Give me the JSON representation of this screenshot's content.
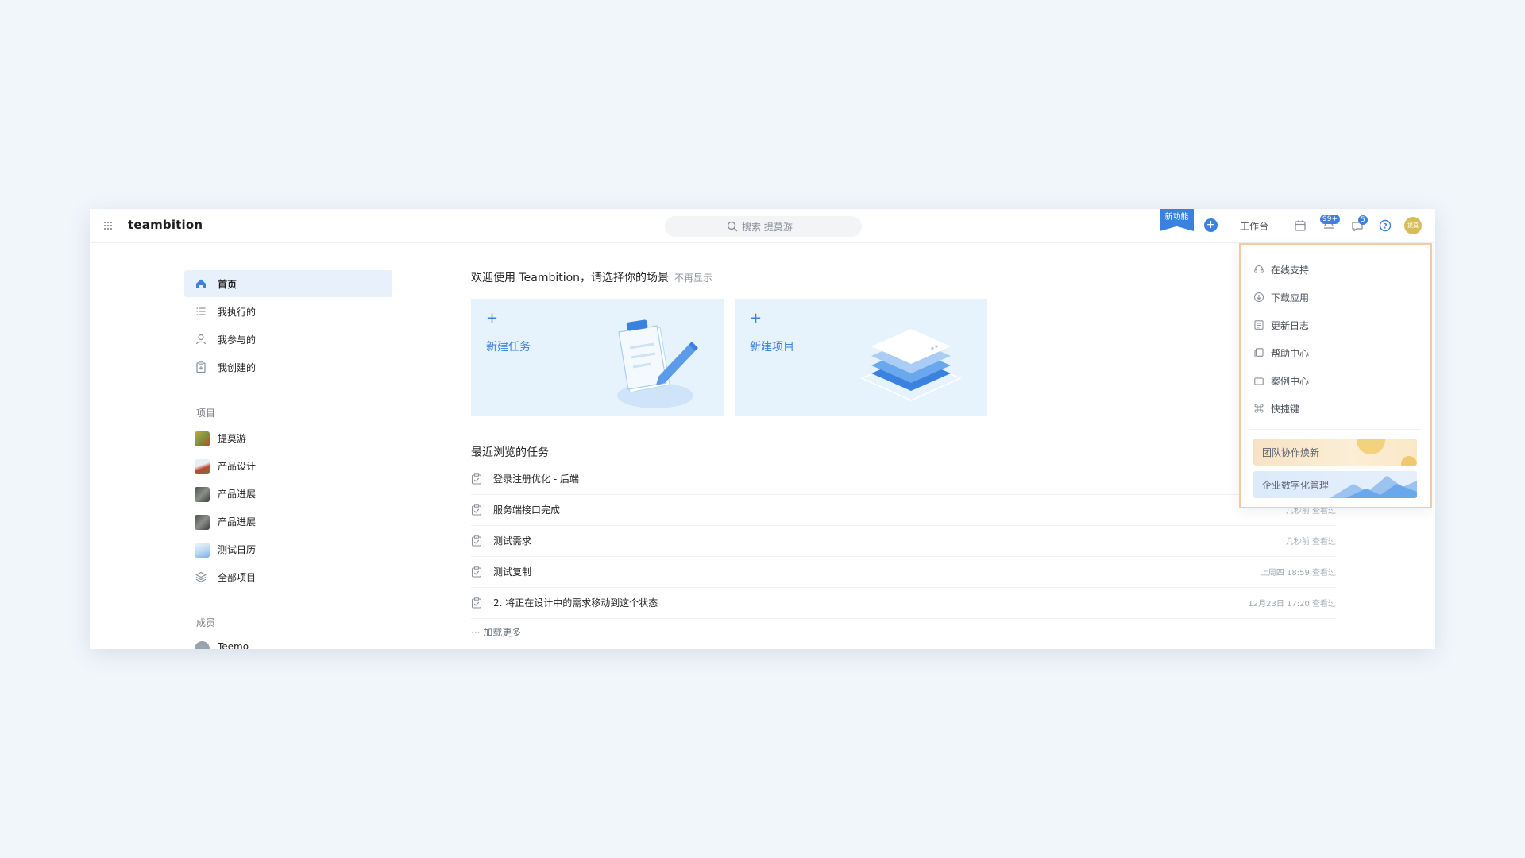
{
  "header": {
    "brand": "teambition",
    "search_placeholder": "搜索 提莫游",
    "new_feature": "新功能",
    "plus": "+",
    "workbench": "工作台",
    "notifications_badge": "99+",
    "messages_badge": "5",
    "avatar_text": "提莫"
  },
  "sidebar": {
    "nav": [
      {
        "label": "首页",
        "icon": "home-icon"
      },
      {
        "label": "我执行的",
        "icon": "list-icon"
      },
      {
        "label": "我参与的",
        "icon": "user-icon"
      },
      {
        "label": "我创建的",
        "icon": "clipboard-icon"
      }
    ],
    "projects_header": "项目",
    "projects": [
      {
        "label": "提莫游"
      },
      {
        "label": "产品设计"
      },
      {
        "label": "产品进展"
      },
      {
        "label": "产品进展"
      },
      {
        "label": "测试日历"
      },
      {
        "label": "全部项目"
      }
    ],
    "members_header": "成员",
    "members": [
      {
        "label": "Teemo"
      }
    ]
  },
  "main": {
    "welcome": "欢迎使用 Teambition，请选择你的场景",
    "dismiss": "不再显示",
    "cards": [
      {
        "plus": "+",
        "title": "新建任务"
      },
      {
        "plus": "+",
        "title": "新建项目"
      }
    ],
    "recent_header": "最近浏览的任务",
    "tasks": [
      {
        "title": "登录注册优化 - 后端",
        "time": ""
      },
      {
        "title": "服务端接口完成",
        "time": "几秒前 查看过"
      },
      {
        "title": "测试需求",
        "time": "几秒前 查看过"
      },
      {
        "title": "测试复制",
        "time": "上周四 18:59 查看过"
      },
      {
        "title": "2. 将正在设计中的需求移动到这个状态",
        "time": "12月23日 17:20 查看过"
      }
    ],
    "load_more": "··· 加载更多"
  },
  "help_menu": {
    "items": [
      {
        "label": "在线支持",
        "icon": "headset-icon"
      },
      {
        "label": "下载应用",
        "icon": "download-icon"
      },
      {
        "label": "更新日志",
        "icon": "log-icon"
      },
      {
        "label": "帮助中心",
        "icon": "book-icon"
      },
      {
        "label": "案例中心",
        "icon": "briefcase-icon"
      },
      {
        "label": "快捷键",
        "icon": "command-icon"
      }
    ],
    "banners": [
      {
        "label": "团队协作焕新"
      },
      {
        "label": "企业数字化管理"
      }
    ]
  },
  "colors": {
    "accent": "#3b82e0",
    "highlight_border": "#f5c9a4"
  }
}
